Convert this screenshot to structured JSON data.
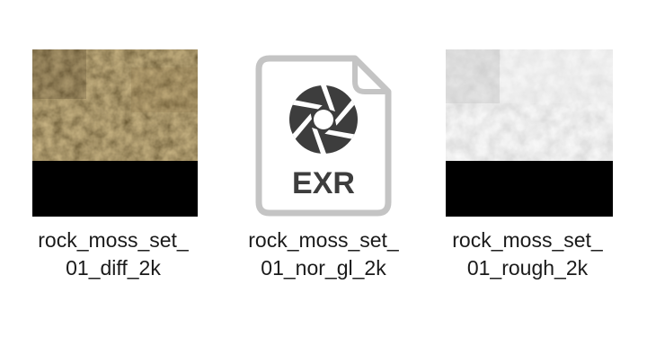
{
  "files": [
    {
      "name_line1": "rock_moss_set_",
      "name_line2": "01_diff_2k",
      "thumbnail": "diffuse-texture-thumbnail"
    },
    {
      "name_line1": "rock_moss_set_",
      "name_line2": "01_nor_gl_2k",
      "thumbnail": "exr-file-icon",
      "icon_text": "EXR"
    },
    {
      "name_line1": "rock_moss_set_",
      "name_line2": "01_rough_2k",
      "thumbnail": "roughness-texture-thumbnail"
    }
  ],
  "colors": {
    "diffuse_base": "#6b5a36",
    "roughness_base": "#d8d8d8",
    "exr_outline": "#c4c4c4",
    "exr_glyph": "#3d3d3d",
    "alpha_band": "#000000"
  }
}
